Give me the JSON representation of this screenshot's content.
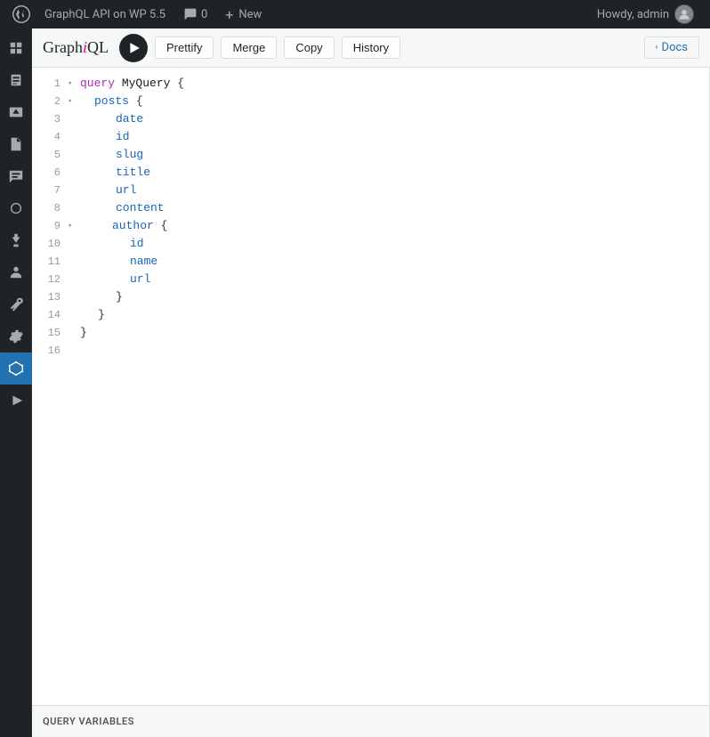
{
  "adminbar": {
    "logo_title": "WordPress",
    "site_name": "GraphQL API on WP 5.5",
    "comments_icon": "comment-icon",
    "comments_count": "0",
    "new_label": "New",
    "user_greeting": "Howdy, admin",
    "user_avatar_alt": "admin avatar"
  },
  "sidebar": {
    "items": [
      {
        "name": "dashboard-icon",
        "label": "Dashboard"
      },
      {
        "name": "posts-icon",
        "label": "Posts"
      },
      {
        "name": "media-icon",
        "label": "Media"
      },
      {
        "name": "pages-icon",
        "label": "Pages"
      },
      {
        "name": "comments-icon",
        "label": "Comments"
      },
      {
        "name": "appearance-icon",
        "label": "Appearance"
      },
      {
        "name": "plugins-icon",
        "label": "Plugins"
      },
      {
        "name": "users-icon",
        "label": "Users"
      },
      {
        "name": "tools-icon",
        "label": "Tools"
      },
      {
        "name": "settings-icon",
        "label": "Settings"
      },
      {
        "name": "graphql-icon",
        "label": "GraphQL API",
        "active": true
      },
      {
        "name": "play-icon",
        "label": "Play"
      }
    ]
  },
  "graphiql": {
    "logo": "GraphiQL",
    "logo_i": "i",
    "run_button_label": "Run query",
    "prettify_label": "Prettify",
    "merge_label": "Merge",
    "copy_label": "Copy",
    "history_label": "History",
    "docs_label": "Docs",
    "query_variables_label": "QUERY VARIABLES"
  },
  "editor": {
    "lines": [
      {
        "num": "1",
        "fold": "▾",
        "indent": 0,
        "tokens": [
          {
            "t": "kw",
            "v": "query"
          },
          {
            "t": "sp",
            "v": " "
          },
          {
            "t": "name",
            "v": "MyQuery"
          },
          {
            "t": "sp",
            "v": " "
          },
          {
            "t": "brace",
            "v": "{"
          }
        ]
      },
      {
        "num": "2",
        "fold": "▾",
        "indent": 1,
        "tokens": [
          {
            "t": "field",
            "v": "posts"
          },
          {
            "t": "sp",
            "v": " "
          },
          {
            "t": "brace",
            "v": "{"
          }
        ]
      },
      {
        "num": "3",
        "fold": "",
        "indent": 2,
        "tokens": [
          {
            "t": "field",
            "v": "date"
          }
        ]
      },
      {
        "num": "4",
        "fold": "",
        "indent": 2,
        "tokens": [
          {
            "t": "field",
            "v": "id"
          }
        ]
      },
      {
        "num": "5",
        "fold": "",
        "indent": 2,
        "tokens": [
          {
            "t": "field",
            "v": "slug"
          }
        ]
      },
      {
        "num": "6",
        "fold": "",
        "indent": 2,
        "tokens": [
          {
            "t": "field",
            "v": "title"
          }
        ]
      },
      {
        "num": "7",
        "fold": "",
        "indent": 2,
        "tokens": [
          {
            "t": "field",
            "v": "url"
          }
        ]
      },
      {
        "num": "8",
        "fold": "",
        "indent": 2,
        "tokens": [
          {
            "t": "field",
            "v": "content"
          }
        ]
      },
      {
        "num": "9",
        "fold": "▾",
        "indent": 2,
        "tokens": [
          {
            "t": "field",
            "v": "author"
          },
          {
            "t": "sp",
            "v": " "
          },
          {
            "t": "brace",
            "v": "{"
          }
        ]
      },
      {
        "num": "10",
        "fold": "",
        "indent": 3,
        "tokens": [
          {
            "t": "field",
            "v": "id"
          }
        ]
      },
      {
        "num": "11",
        "fold": "",
        "indent": 3,
        "tokens": [
          {
            "t": "field",
            "v": "name"
          }
        ]
      },
      {
        "num": "12",
        "fold": "",
        "indent": 3,
        "tokens": [
          {
            "t": "field",
            "v": "url"
          }
        ]
      },
      {
        "num": "13",
        "fold": "",
        "indent": 2,
        "tokens": [
          {
            "t": "brace",
            "v": "}"
          }
        ]
      },
      {
        "num": "14",
        "fold": "",
        "indent": 1,
        "tokens": [
          {
            "t": "brace",
            "v": "}"
          }
        ]
      },
      {
        "num": "15",
        "fold": "",
        "indent": 0,
        "tokens": [
          {
            "t": "brace",
            "v": "}"
          }
        ]
      },
      {
        "num": "16",
        "fold": "",
        "indent": 0,
        "tokens": []
      }
    ]
  }
}
